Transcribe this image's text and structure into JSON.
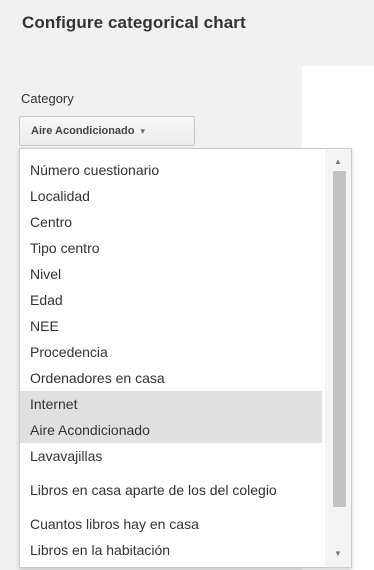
{
  "panel": {
    "title": "Configure categorical chart"
  },
  "category": {
    "label": "Category",
    "selected": "Aire Acondicionado",
    "arrow_icon": "chevron-down-icon"
  },
  "list": {
    "items": [
      {
        "label": "Número cuestionario",
        "highlighted": false
      },
      {
        "label": "Localidad",
        "highlighted": false
      },
      {
        "label": "Centro",
        "highlighted": false
      },
      {
        "label": "Tipo centro",
        "highlighted": false
      },
      {
        "label": "Nivel",
        "highlighted": false
      },
      {
        "label": "Edad",
        "highlighted": false
      },
      {
        "label": "NEE",
        "highlighted": false
      },
      {
        "label": "Procedencia",
        "highlighted": false
      },
      {
        "label": "Ordenadores en casa",
        "highlighted": false
      },
      {
        "label": "Internet",
        "highlighted": true
      },
      {
        "label": "Aire Acondicionado",
        "highlighted": true
      },
      {
        "label": "Lavavajillas",
        "highlighted": false
      },
      {
        "label": "Libros en casa aparte de los del colegio",
        "highlighted": false
      },
      {
        "label": "Cuantos libros hay en casa",
        "highlighted": false
      },
      {
        "label": "Libros en la habitación",
        "highlighted": false
      }
    ],
    "scroll_up_icon": "scroll-up-arrow-icon",
    "scroll_down_icon": "scroll-down-arrow-icon"
  },
  "colors": {
    "panel_bg": "#f1f1f1",
    "highlight": "#e0e0e0",
    "text": "#333333"
  }
}
